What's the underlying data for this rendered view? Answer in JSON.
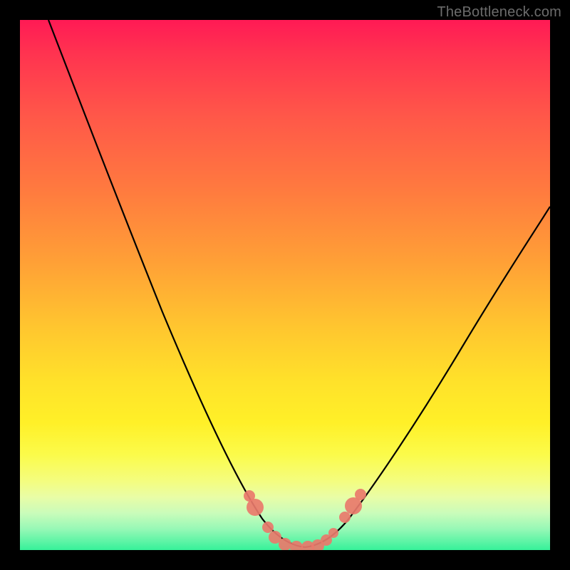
{
  "watermark": "TheBottleneck.com",
  "chart_data": {
    "type": "line",
    "title": "",
    "xlabel": "",
    "ylabel": "",
    "xlim": [
      0,
      100
    ],
    "ylim": [
      0,
      100
    ],
    "grid": false,
    "legend": false,
    "series": [
      {
        "name": "curve",
        "x": [
          5,
          10,
          15,
          20,
          25,
          30,
          35,
          40,
          44,
          47,
          50,
          53,
          56,
          58,
          62,
          66,
          70,
          75,
          80,
          85,
          90,
          95,
          100
        ],
        "values": [
          100,
          87,
          74,
          62,
          50,
          39,
          28,
          18,
          10,
          5,
          2,
          1,
          1,
          2,
          5,
          10,
          16,
          24,
          32,
          41,
          50,
          59,
          68
        ]
      }
    ],
    "markers": [
      {
        "x": 43,
        "y": 10,
        "r": 1.2
      },
      {
        "x": 44,
        "y": 8,
        "r": 1.8
      },
      {
        "x": 47,
        "y": 4,
        "r": 1.2
      },
      {
        "x": 48,
        "y": 2,
        "r": 1.4
      },
      {
        "x": 50,
        "y": 1,
        "r": 1.4
      },
      {
        "x": 52,
        "y": 1,
        "r": 1.4
      },
      {
        "x": 54,
        "y": 1,
        "r": 1.4
      },
      {
        "x": 56,
        "y": 1,
        "r": 1.4
      },
      {
        "x": 57,
        "y": 2,
        "r": 1.4
      },
      {
        "x": 58,
        "y": 3,
        "r": 1.2
      },
      {
        "x": 61,
        "y": 6,
        "r": 1.2
      },
      {
        "x": 63,
        "y": 8,
        "r": 1.8
      },
      {
        "x": 64,
        "y": 10,
        "r": 1.2
      }
    ],
    "gradient_colors": {
      "top": "#ff1a55",
      "mid_upper": "#ff9a38",
      "mid": "#ffe12a",
      "lower": "#f4fd7f",
      "bottom": "#36f19a"
    },
    "background_frame": "#000000",
    "curve_color": "#000000",
    "marker_color": "#e9796b"
  }
}
